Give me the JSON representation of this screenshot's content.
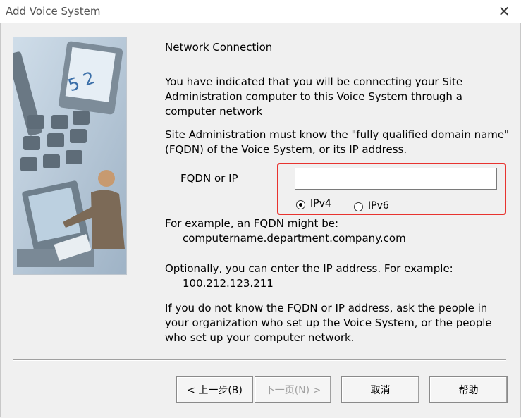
{
  "window": {
    "title": "Add Voice System"
  },
  "content": {
    "heading": "Network Connection",
    "intro_lines": [
      "You have indicated that you will be connecting your Site",
      "Administration computer to this Voice System through a",
      "computer network"
    ],
    "fqdn_lines": [
      "Site Administration must know the \"fully qualified domain name\"",
      "(FQDN) of the Voice System, or its IP address."
    ],
    "field_label": "FQDN or IP",
    "field_value": "",
    "radio_ipv4": "IPv4",
    "radio_ipv6": "IPv6",
    "example_fqdn_line": "For example, an FQDN might be:",
    "example_fqdn_value": "computername.department.company.com",
    "example_ip_line": "Optionally, you can enter the IP address.  For example:",
    "example_ip_value": "100.212.123.211",
    "help_lines": [
      "If you do not know the FQDN or IP address, ask the people in",
      "your organization who set up the Voice System, or the people",
      "who set up your computer network."
    ]
  },
  "buttons": {
    "back": "< 上一步(B)",
    "next": "下一页(N) >",
    "cancel": "取消",
    "help": "帮助"
  },
  "colors": {
    "highlight": "#e8332f",
    "background": "#f0f0f0"
  }
}
